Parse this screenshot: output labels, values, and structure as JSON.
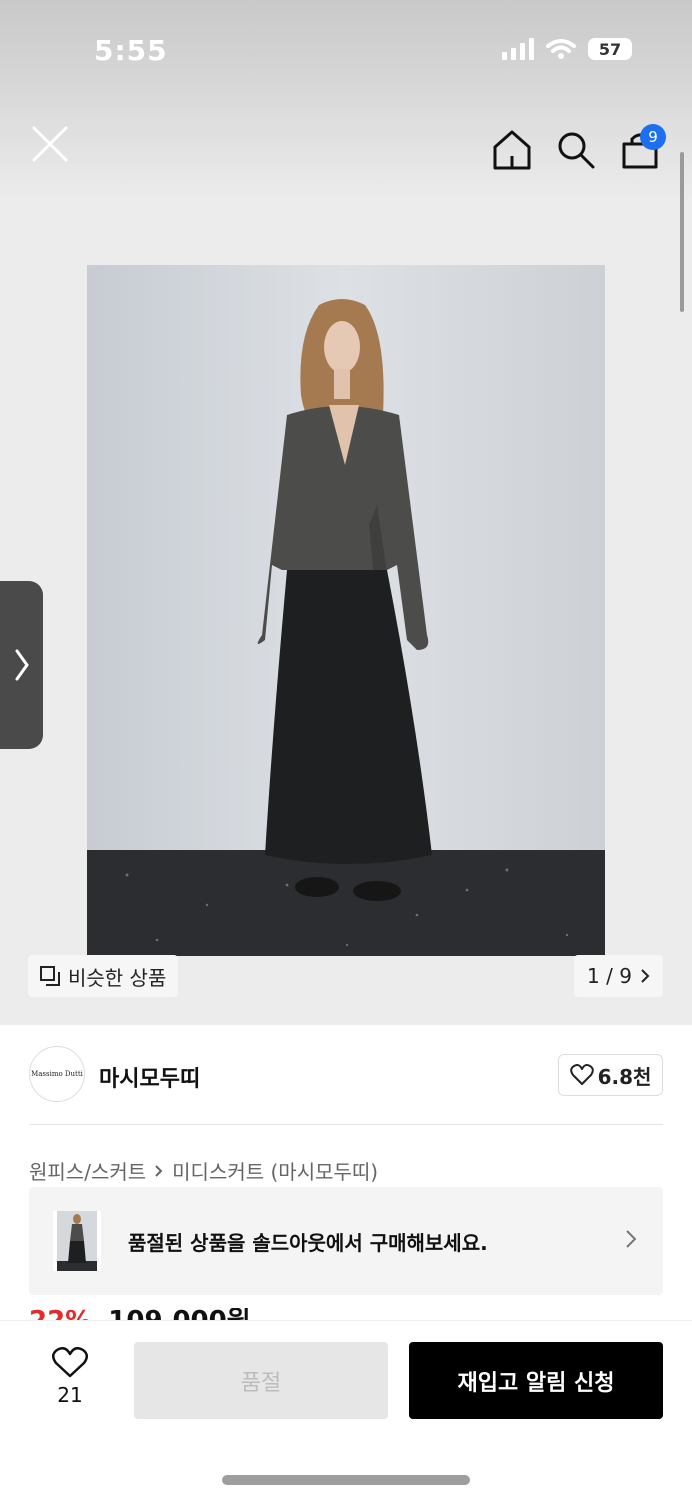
{
  "status_bar": {
    "time": "5:55",
    "battery": "57"
  },
  "header": {
    "close_icon": "close-icon",
    "home_icon": "home-icon",
    "search_icon": "search-icon",
    "bag_icon": "shopping-bag-icon",
    "bag_count": "9",
    "badge_color": "#1e6ff0"
  },
  "gallery": {
    "similar_label": "비슷한 상품",
    "pager": "1 / 9"
  },
  "brand": {
    "logo_text": "Massimo Dutti",
    "name": "마시모두띠",
    "likes": "6.8천"
  },
  "breadcrumb": {
    "category": "원피스/스커트",
    "subcategory": "미디스커트 (마시모두띠)"
  },
  "banner": {
    "text": "품절된 상품을 솔드아웃에서 구매해보세요."
  },
  "price": {
    "discount": "22%",
    "amount": "109,000원"
  },
  "bottom_bar": {
    "wish_count": "21",
    "soldout_label": "품절",
    "restock_label": "재입고 알림 신청"
  }
}
